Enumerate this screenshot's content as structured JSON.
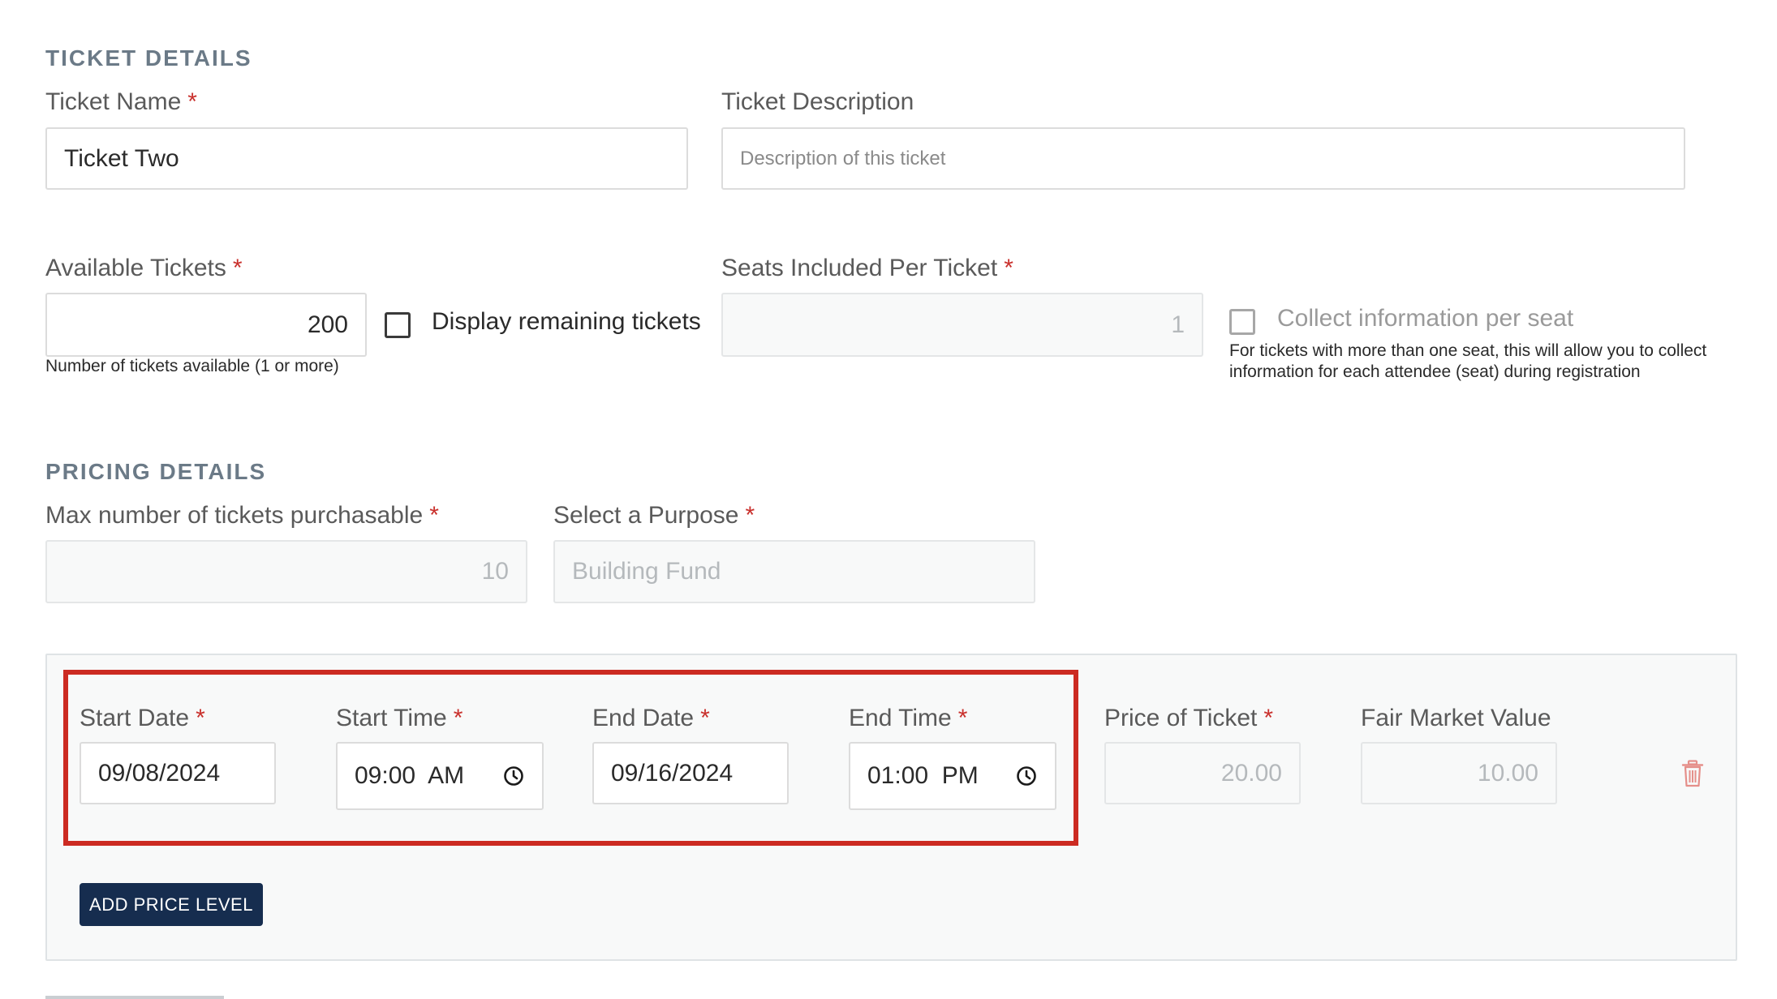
{
  "ticket_details": {
    "section_title": "TICKET DETAILS",
    "name_label": "Ticket Name",
    "name_value": "Ticket Two",
    "description_label": "Ticket Description",
    "description_placeholder": "Description of this ticket",
    "available_label": "Available Tickets",
    "available_value": "200",
    "available_help": "Number of tickets available (1 or more)",
    "display_remaining_label": "Display remaining tickets",
    "seats_label": "Seats Included Per Ticket",
    "seats_value": "1",
    "collect_label": "Collect information per seat",
    "collect_help_line1": "For tickets with more than one seat, this will allow you to collect",
    "collect_help_line2": "information for each attendee (seat) during registration"
  },
  "pricing_details": {
    "section_title": "PRICING DETAILS",
    "max_label": "Max number of tickets purchasable",
    "max_value": "10",
    "purpose_label": "Select a Purpose",
    "purpose_value": "Building Fund",
    "price_level": {
      "start_date_label": "Start Date",
      "start_date_value": "09/08/2024",
      "start_time_label": "Start Time",
      "start_time_value": "09:00  AM",
      "end_date_label": "End Date",
      "end_date_value": "09/16/2024",
      "end_time_label": "End Time",
      "end_time_value": "01:00  PM",
      "price_label": "Price of Ticket",
      "price_value": "20.00",
      "fmv_label": "Fair Market Value",
      "fmv_value": "10.00"
    },
    "add_price_level_label": "ADD PRICE LEVEL"
  },
  "required_marker": "*",
  "colors": {
    "required": "#c9302c",
    "highlight": "#cc2b22",
    "button_bg": "#162d4f",
    "section_title": "#6b7a87"
  },
  "icons": {
    "clock": "clock-icon",
    "trash": "trash-icon"
  }
}
